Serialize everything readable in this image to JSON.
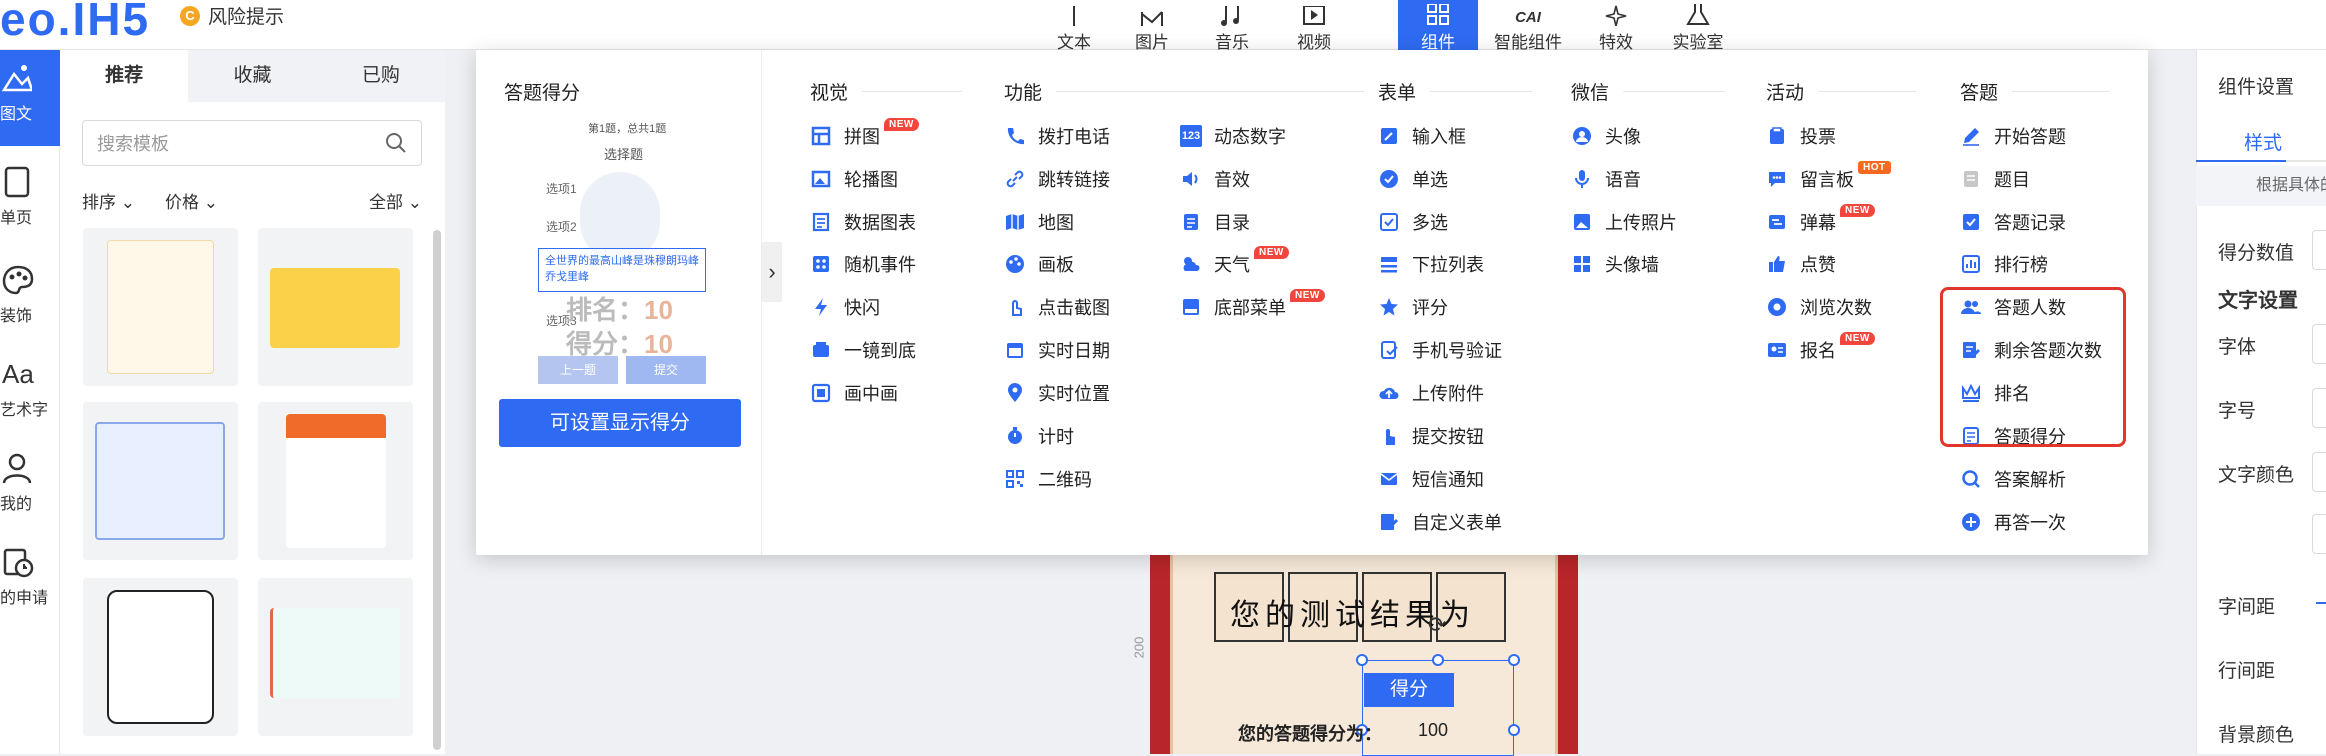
{
  "app": {
    "logo": "eo.IH5",
    "risk_label": "风险提示",
    "risk_icon": "C"
  },
  "toolbar": {
    "tools": [
      "文本",
      "图片",
      "音乐",
      "视频"
    ],
    "tools2": [
      "组件",
      "智能组件",
      "特效",
      "实验室"
    ],
    "ai_icon_text": "CAI"
  },
  "rail": {
    "items": [
      "图文",
      "单页",
      "装饰",
      "艺术字",
      "我的",
      "的申请"
    ],
    "aa": "Aa"
  },
  "templates": {
    "tabs": [
      "推荐",
      "收藏",
      "已购"
    ],
    "search_placeholder": "搜索模板",
    "sort": "排序",
    "price": "价格",
    "all": "全部"
  },
  "popup": {
    "preview": {
      "title": "答题得分",
      "progress": "第1题，总共1题",
      "question": "选择题",
      "options": [
        "选项1",
        "选项2",
        "选项3"
      ],
      "selected_text": "全世界的最高山峰是珠穆朗玛峰乔戈里峰",
      "rank_label": "排名：",
      "rank_value": "10",
      "score_label": "得分：",
      "score_value": "10",
      "prev_btn": "上一题",
      "submit_btn": "提交",
      "main_btn": "可设置显示得分"
    },
    "columns": {
      "visual": {
        "title": "视觉",
        "items": [
          "拼图",
          "轮播图",
          "数据图表",
          "随机事件",
          "快闪",
          "一镜到底",
          "画中画"
        ]
      },
      "func1": {
        "title": "功能",
        "items": [
          "拨打电话",
          "跳转链接",
          "地图",
          "画板",
          "点击截图",
          "实时日期",
          "实时位置",
          "计时",
          "二维码"
        ]
      },
      "func2": {
        "items": [
          "动态数字",
          "音效",
          "目录",
          "天气",
          "底部菜单"
        ],
        "num_icon": "123"
      },
      "form": {
        "title": "表单",
        "items": [
          "输入框",
          "单选",
          "多选",
          "下拉列表",
          "评分",
          "手机号验证",
          "上传附件",
          "提交按钮",
          "短信通知",
          "自定义表单"
        ]
      },
      "wechat": {
        "title": "微信",
        "items": [
          "头像",
          "语音",
          "上传照片",
          "头像墙"
        ]
      },
      "activity": {
        "title": "活动",
        "items": [
          "投票",
          "留言板",
          "弹幕",
          "点赞",
          "浏览次数",
          "报名"
        ]
      },
      "quiz": {
        "title": "答题",
        "items": [
          "开始答题",
          "题目",
          "答题记录",
          "排行榜",
          "答题人数",
          "剩余答题次数",
          "排名",
          "答题得分",
          "答案解析",
          "再答一次"
        ]
      }
    },
    "badges": {
      "new": "NEW",
      "hot": "HOT"
    }
  },
  "canvas": {
    "result_text": "您的测试结果为",
    "score_btn": "得分",
    "score_line": "您的答题得分为：",
    "score_value": "100",
    "ruler": "200"
  },
  "right": {
    "title": "组件设置",
    "tab": "样式",
    "note": "根据具体的",
    "rows": [
      "得分数值",
      "文字设置",
      "字体",
      "字号",
      "文字颜色",
      "字间距",
      "行间距",
      "背景颜色"
    ]
  },
  "colors": {
    "accent": "#2f6bf2",
    "highlight": "#e0362c"
  }
}
